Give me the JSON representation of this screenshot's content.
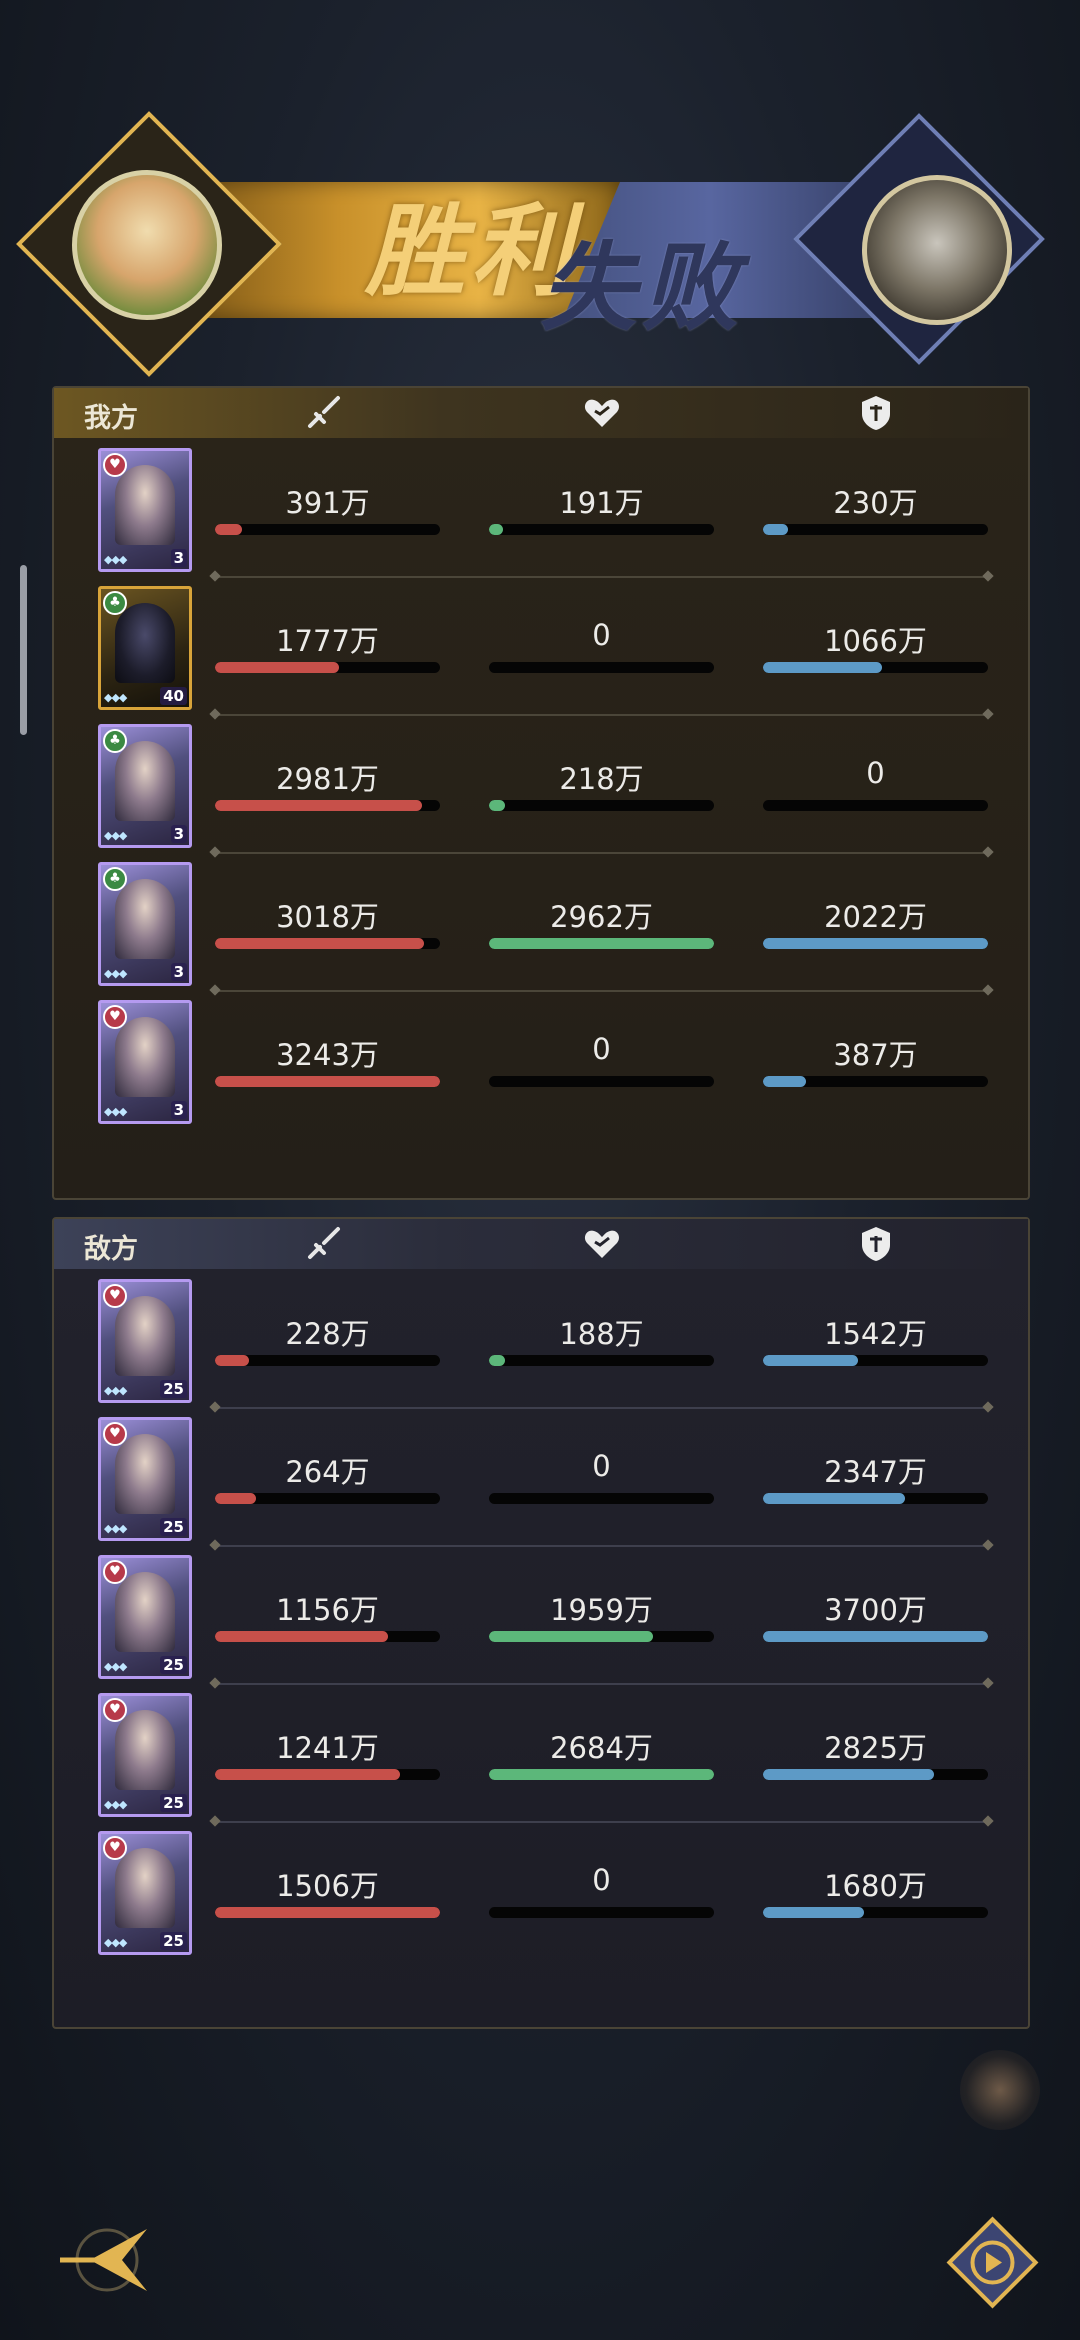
{
  "banner": {
    "victory_text": "胜利",
    "defeat_text": "失败"
  },
  "ally": {
    "title": "我方",
    "rows": [
      {
        "level": "3",
        "badge": "heart",
        "attack": "391万",
        "heal": "191万",
        "defense": "230万",
        "attack_pct": 12,
        "heal_pct": 6,
        "defense_pct": 11
      },
      {
        "level": "40",
        "badge": "club",
        "attack": "1777万",
        "heal": "0",
        "defense": "1066万",
        "attack_pct": 55,
        "heal_pct": 0,
        "defense_pct": 53
      },
      {
        "level": "3",
        "badge": "club",
        "attack": "2981万",
        "heal": "218万",
        "defense": "0",
        "attack_pct": 92,
        "heal_pct": 7,
        "defense_pct": 0
      },
      {
        "level": "3",
        "badge": "club",
        "attack": "3018万",
        "heal": "2962万",
        "defense": "2022万",
        "attack_pct": 93,
        "heal_pct": 100,
        "defense_pct": 100
      },
      {
        "level": "3",
        "badge": "heart",
        "attack": "3243万",
        "heal": "0",
        "defense": "387万",
        "attack_pct": 100,
        "heal_pct": 0,
        "defense_pct": 19
      }
    ]
  },
  "enemy": {
    "title": "敌方",
    "rows": [
      {
        "level": "25",
        "badge": "heart",
        "attack": "228万",
        "heal": "188万",
        "defense": "1542万",
        "attack_pct": 15,
        "heal_pct": 7,
        "defense_pct": 42
      },
      {
        "level": "25",
        "badge": "heart",
        "attack": "264万",
        "heal": "0",
        "defense": "2347万",
        "attack_pct": 18,
        "heal_pct": 0,
        "defense_pct": 63
      },
      {
        "level": "25",
        "badge": "heart",
        "attack": "1156万",
        "heal": "1959万",
        "defense": "3700万",
        "attack_pct": 77,
        "heal_pct": 73,
        "defense_pct": 100
      },
      {
        "level": "25",
        "badge": "heart",
        "attack": "1241万",
        "heal": "2684万",
        "defense": "2825万",
        "attack_pct": 82,
        "heal_pct": 100,
        "defense_pct": 76
      },
      {
        "level": "25",
        "badge": "heart",
        "attack": "1506万",
        "heal": "0",
        "defense": "1680万",
        "attack_pct": 100,
        "heal_pct": 0,
        "defense_pct": 45
      }
    ]
  },
  "icons": {
    "attack": "sword-icon",
    "heal": "heart-icon",
    "defense": "shield-icon",
    "back": "back-arrow-icon",
    "replay": "replay-icon"
  },
  "colors": {
    "attack": "#c7504a",
    "heal": "#5cb77a",
    "defense": "#5d9ac6",
    "gold": "#e8b345"
  }
}
